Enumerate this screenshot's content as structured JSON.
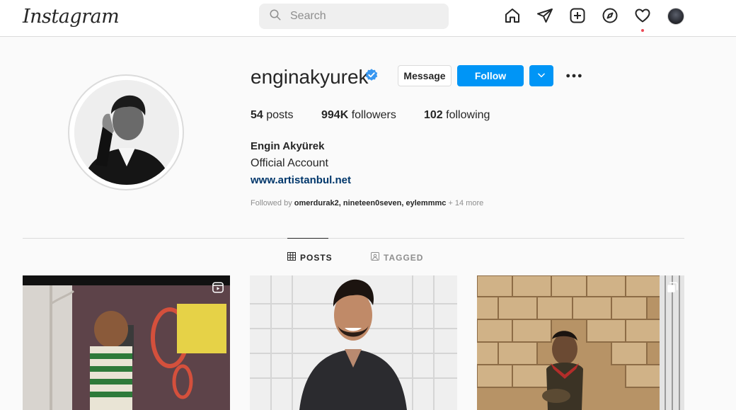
{
  "app": {
    "logo_text": "Instagram"
  },
  "search": {
    "placeholder": "Search"
  },
  "nav": {
    "icons": [
      "home-icon",
      "direct-message-icon",
      "new-post-icon",
      "explore-icon",
      "activity-heart-icon",
      "profile-avatar"
    ],
    "has_notification": true
  },
  "profile": {
    "username": "enginakyurek",
    "verified": true,
    "buttons": {
      "message": "Message",
      "follow": "Follow"
    },
    "stats": {
      "posts_count": "54",
      "posts_label": "posts",
      "followers_count": "994K",
      "followers_label": "followers",
      "following_count": "102",
      "following_label": "following"
    },
    "bio": {
      "name": "Engin Akyürek",
      "category": "Official Account",
      "link": "www.artistanbul.net"
    },
    "followed_by": {
      "prefix": "Followed by",
      "names": "omerdurak2, nineteen0seven, eylemmmc",
      "more": "+ 14 more"
    }
  },
  "tabs": [
    {
      "label": "POSTS",
      "active": true
    },
    {
      "label": "TAGGED",
      "active": false
    }
  ],
  "posts": [
    {
      "type": "reel",
      "badge": "reels-icon"
    },
    {
      "type": "photo",
      "badge": null
    },
    {
      "type": "carousel",
      "badge": "carousel-icon"
    }
  ],
  "colors": {
    "accent": "#0095f6",
    "link": "#00376b",
    "verified": "#3897f0",
    "notification": "#ed4956"
  }
}
